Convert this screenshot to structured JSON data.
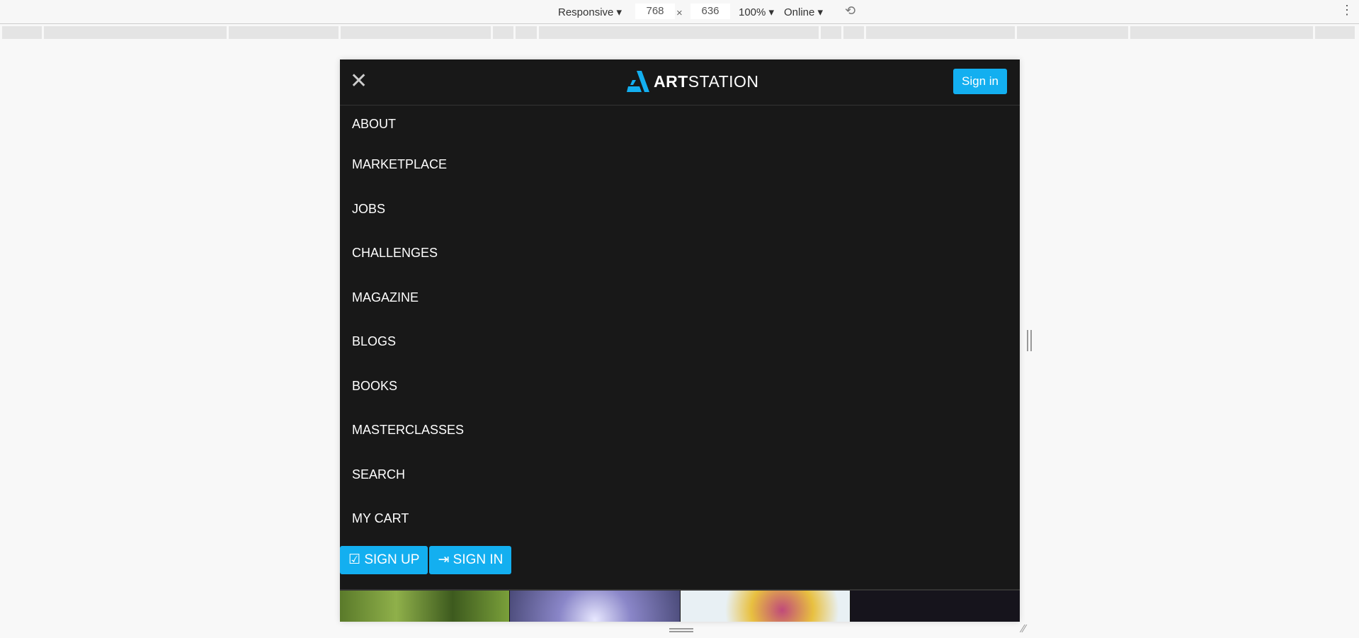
{
  "devtools": {
    "device": "Responsive",
    "width": "768",
    "times": "×",
    "height": "636",
    "zoom": "100%",
    "network": "Online"
  },
  "header": {
    "logo_bold": "ART",
    "logo_light": "STATION",
    "sign_in": "Sign in"
  },
  "menu": [
    "ABOUT",
    "MARKETPLACE",
    "JOBS",
    "CHALLENGES",
    "MAGAZINE",
    "BLOGS",
    "BOOKS",
    "MASTERCLASSES",
    "SEARCH",
    "MY CART"
  ],
  "actions": {
    "sign_up": "SIGN UP",
    "sign_in": "SIGN IN"
  },
  "colors": {
    "accent": "#13aff0",
    "background": "#181818"
  }
}
